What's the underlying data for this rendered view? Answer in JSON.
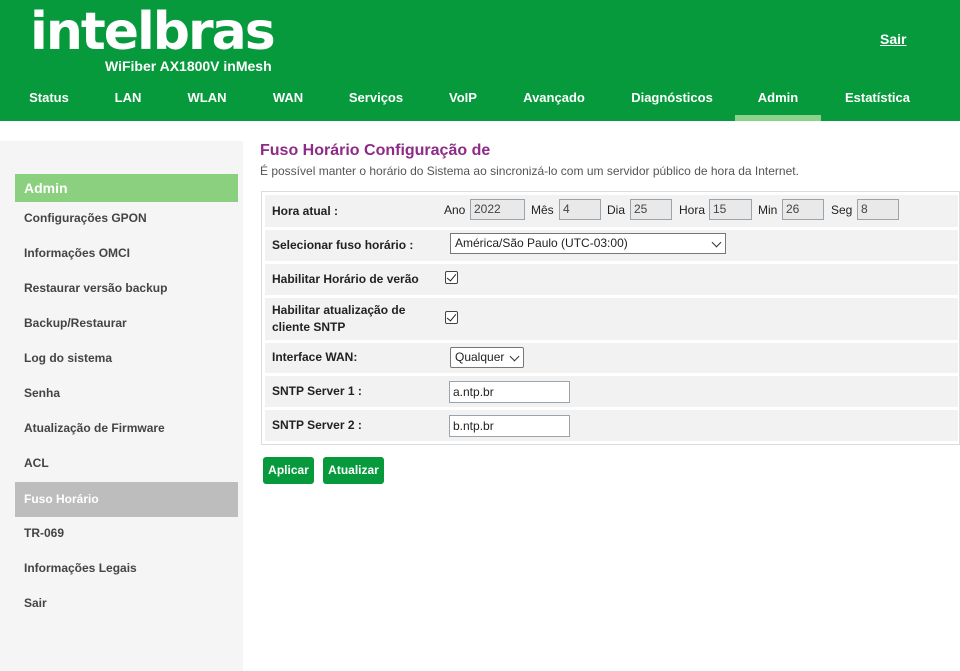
{
  "header": {
    "logo_text": "intelbras",
    "model": "WiFiber AX1800V inMesh",
    "logout_label": "Sair"
  },
  "nav": [
    {
      "label": "Status"
    },
    {
      "label": "LAN"
    },
    {
      "label": "WLAN"
    },
    {
      "label": "WAN"
    },
    {
      "label": "Serviços"
    },
    {
      "label": "VoIP"
    },
    {
      "label": "Avançado"
    },
    {
      "label": "Diagnósticos"
    },
    {
      "label": "Admin"
    },
    {
      "label": "Estatística"
    }
  ],
  "nav_active": "Admin",
  "sidebar": {
    "title": "Admin",
    "items": [
      {
        "label": "Configurações GPON"
      },
      {
        "label": "Informações OMCI"
      },
      {
        "label": "Restaurar versão backup"
      },
      {
        "label": "Backup/Restaurar"
      },
      {
        "label": "Log do sistema"
      },
      {
        "label": "Senha"
      },
      {
        "label": "Atualização de Firmware"
      },
      {
        "label": "ACL"
      },
      {
        "label": "Fuso Horário"
      },
      {
        "label": "TR-069"
      },
      {
        "label": "Informações Legais"
      },
      {
        "label": "Sair"
      }
    ],
    "active": "Fuso Horário"
  },
  "main": {
    "title": "Fuso Horário Configuração de",
    "description": "É possível manter o horário do Sistema ao sincronizá-lo com um servidor público de hora da Internet.",
    "current_time": {
      "label": "Hora atual :",
      "year_label": "Ano",
      "year": "2022",
      "month_label": "Mês",
      "month": "4",
      "day_label": "Dia",
      "day": "25",
      "hour_label": "Hora",
      "hour": "15",
      "min_label": "Min",
      "min": "26",
      "sec_label": "Seg",
      "sec": "8"
    },
    "timezone": {
      "label": "Selecionar fuso horário :",
      "selected": "América/São Paulo (UTC-03:00)"
    },
    "dst": {
      "label": "Habilitar Horário de verão",
      "checked": true
    },
    "sntp_client": {
      "label": "Habilitar atualização de cliente SNTP",
      "checked": true
    },
    "wan_interface": {
      "label": "Interface WAN:",
      "selected": "Qualquer"
    },
    "sntp_server1": {
      "label": "SNTP Server 1 :",
      "value": "a.ntp.br"
    },
    "sntp_server2": {
      "label": "SNTP Server 2 :",
      "value": "b.ntp.br"
    },
    "apply_label": "Aplicar",
    "refresh_label": "Atualizar"
  },
  "colors": {
    "brand_green": "#079a3d",
    "title_purple": "#8e2a87",
    "sidebar_title": "#8ad07e",
    "sidebar_active": "#bdbdbd"
  }
}
